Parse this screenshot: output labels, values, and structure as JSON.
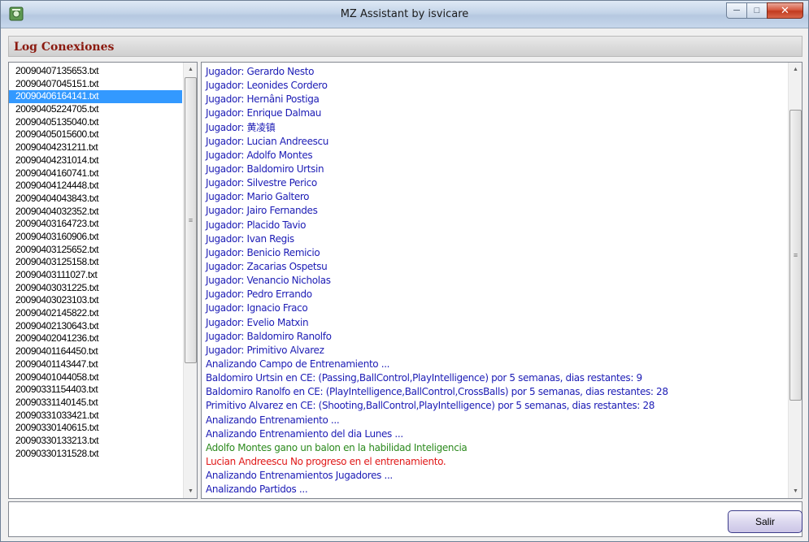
{
  "window": {
    "title": "MZ Assistant by isvicare",
    "controls": {
      "minimize": "─",
      "maximize": "□",
      "close": "✕"
    }
  },
  "section": {
    "title": "Log Conexiones"
  },
  "files": {
    "selected_index": 2,
    "items": [
      "20090407135653.txt",
      "20090407045151.txt",
      "20090406164141.txt",
      "20090405224705.txt",
      "20090405135040.txt",
      "20090405015600.txt",
      "20090404231211.txt",
      "20090404231014.txt",
      "20090404160741.txt",
      "20090404124448.txt",
      "20090404043843.txt",
      "20090404032352.txt",
      "20090403164723.txt",
      "20090403160906.txt",
      "20090403125652.txt",
      "20090403125158.txt",
      "20090403111027.txt",
      "20090403031225.txt",
      "20090403023103.txt",
      "20090402145822.txt",
      "20090402130643.txt",
      "20090402041236.txt",
      "20090401164450.txt",
      "20090401143447.txt",
      "20090401044058.txt",
      "20090331154403.txt",
      "20090331140145.txt",
      "20090331033421.txt",
      "20090330140615.txt",
      "20090330133213.txt",
      "20090330131528.txt"
    ]
  },
  "log": {
    "colors": {
      "info": "#1c1cb5",
      "success": "#2c8a1e",
      "error": "#e01818"
    },
    "lines": [
      {
        "text": "Jugador: Gerardo Nesto",
        "type": "info"
      },
      {
        "text": "Jugador: Leonides Cordero",
        "type": "info"
      },
      {
        "text": "Jugador: Hernâni Postiga",
        "type": "info"
      },
      {
        "text": "Jugador: Enrique Dalmau",
        "type": "info"
      },
      {
        "text": "Jugador: 黄凌镇",
        "type": "info"
      },
      {
        "text": "Jugador: Lucian Andreescu",
        "type": "info"
      },
      {
        "text": "Jugador: Adolfo Montes",
        "type": "info"
      },
      {
        "text": "Jugador: Baldomiro Urtsin",
        "type": "info"
      },
      {
        "text": "Jugador: Silvestre Perico",
        "type": "info"
      },
      {
        "text": "Jugador: Mario Galtero",
        "type": "info"
      },
      {
        "text": "Jugador: Jairo Fernandes",
        "type": "info"
      },
      {
        "text": "Jugador: Placido Tavio",
        "type": "info"
      },
      {
        "text": "Jugador: Ivan Regis",
        "type": "info"
      },
      {
        "text": "Jugador: Benicio Remicio",
        "type": "info"
      },
      {
        "text": "Jugador: Zacarias Ospetsu",
        "type": "info"
      },
      {
        "text": "Jugador: Venancio Nicholas",
        "type": "info"
      },
      {
        "text": "Jugador: Pedro Errando",
        "type": "info"
      },
      {
        "text": "Jugador: Ignacio Fraco",
        "type": "info"
      },
      {
        "text": "Jugador: Evelio Matxin",
        "type": "info"
      },
      {
        "text": "Jugador: Baldomiro Ranolfo",
        "type": "info"
      },
      {
        "text": "Jugador: Primitivo Alvarez",
        "type": "info"
      },
      {
        "text": "Analizando Campo de Entrenamiento ...",
        "type": "info"
      },
      {
        "text": "Baldomiro Urtsin en CE: (Passing,BallControl,PlayIntelligence) por 5 semanas, dias restantes: 9",
        "type": "info"
      },
      {
        "text": "Baldomiro Ranolfo en CE: (PlayIntelligence,BallControl,CrossBalls) por 5 semanas, dias restantes: 28",
        "type": "info"
      },
      {
        "text": "Primitivo Alvarez en CE: (Shooting,BallControl,PlayIntelligence) por 5 semanas, dias restantes: 28",
        "type": "info"
      },
      {
        "text": "Analizando Entrenamiento ...",
        "type": "info"
      },
      {
        "text": "Analizando Entrenamiento del dia Lunes ...",
        "type": "info"
      },
      {
        "text": "Adolfo Montes gano un balon en la habilidad Inteligencia",
        "type": "success"
      },
      {
        "text": "Lucian Andreescu No progreso en el entrenamiento.",
        "type": "error"
      },
      {
        "text": "Analizando Entrenamientos Jugadores ...",
        "type": "info"
      },
      {
        "text": "Analizando Partidos ...",
        "type": "info"
      }
    ]
  },
  "footer": {
    "exit_label": "Salir"
  }
}
